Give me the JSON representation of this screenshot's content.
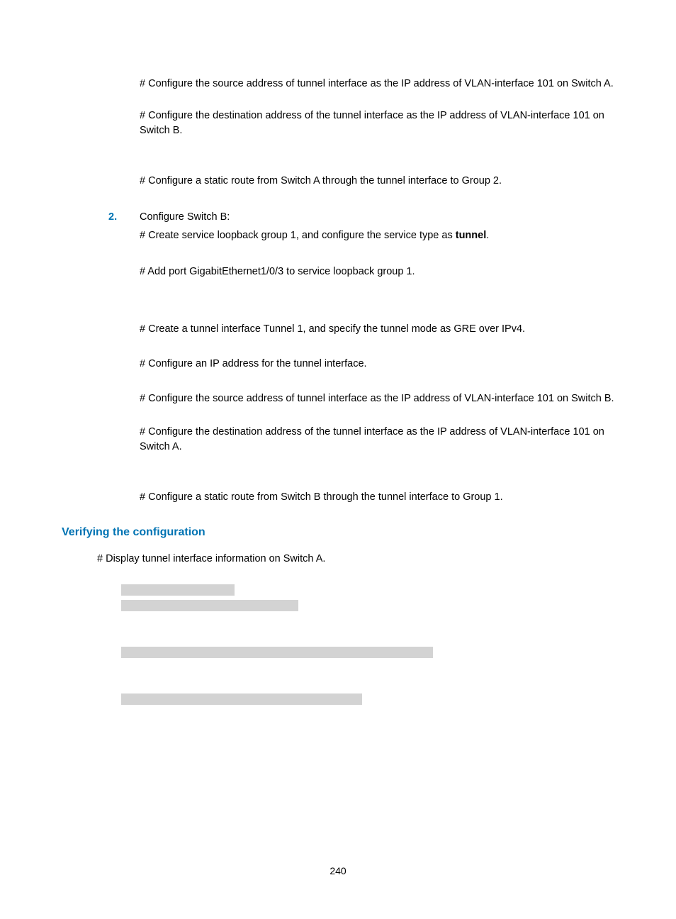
{
  "paras": {
    "p1": "# Configure the source address of tunnel interface as the IP address of VLAN-interface 101 on Switch A.",
    "p2": "# Configure the destination address of the tunnel interface as the IP address of VLAN-interface 101 on Switch B.",
    "p3": "# Configure a static route from Switch A through the tunnel interface to Group 2."
  },
  "step": {
    "num": "2.",
    "title": "Configure Switch B:",
    "s1a": "# Create service loopback group 1, and configure the service type as ",
    "s1b": "tunnel",
    "s1c": ".",
    "s2": "# Add port GigabitEthernet1/0/3 to service loopback group 1.",
    "s3": "# Create a tunnel interface Tunnel 1, and specify the tunnel mode as GRE over IPv4.",
    "s4": "# Configure an IP address for the tunnel interface.",
    "s5": "# Configure the source address of tunnel interface as the IP address of VLAN-interface 101 on Switch B.",
    "s6": "# Configure the destination address of the tunnel interface as the IP address of VLAN-interface 101 on Switch A.",
    "s7": "# Configure a static route from Switch B through the tunnel interface to Group 1."
  },
  "heading": "Verifying the configuration",
  "display": "# Display tunnel interface information on Switch A.",
  "pageNum": "240"
}
